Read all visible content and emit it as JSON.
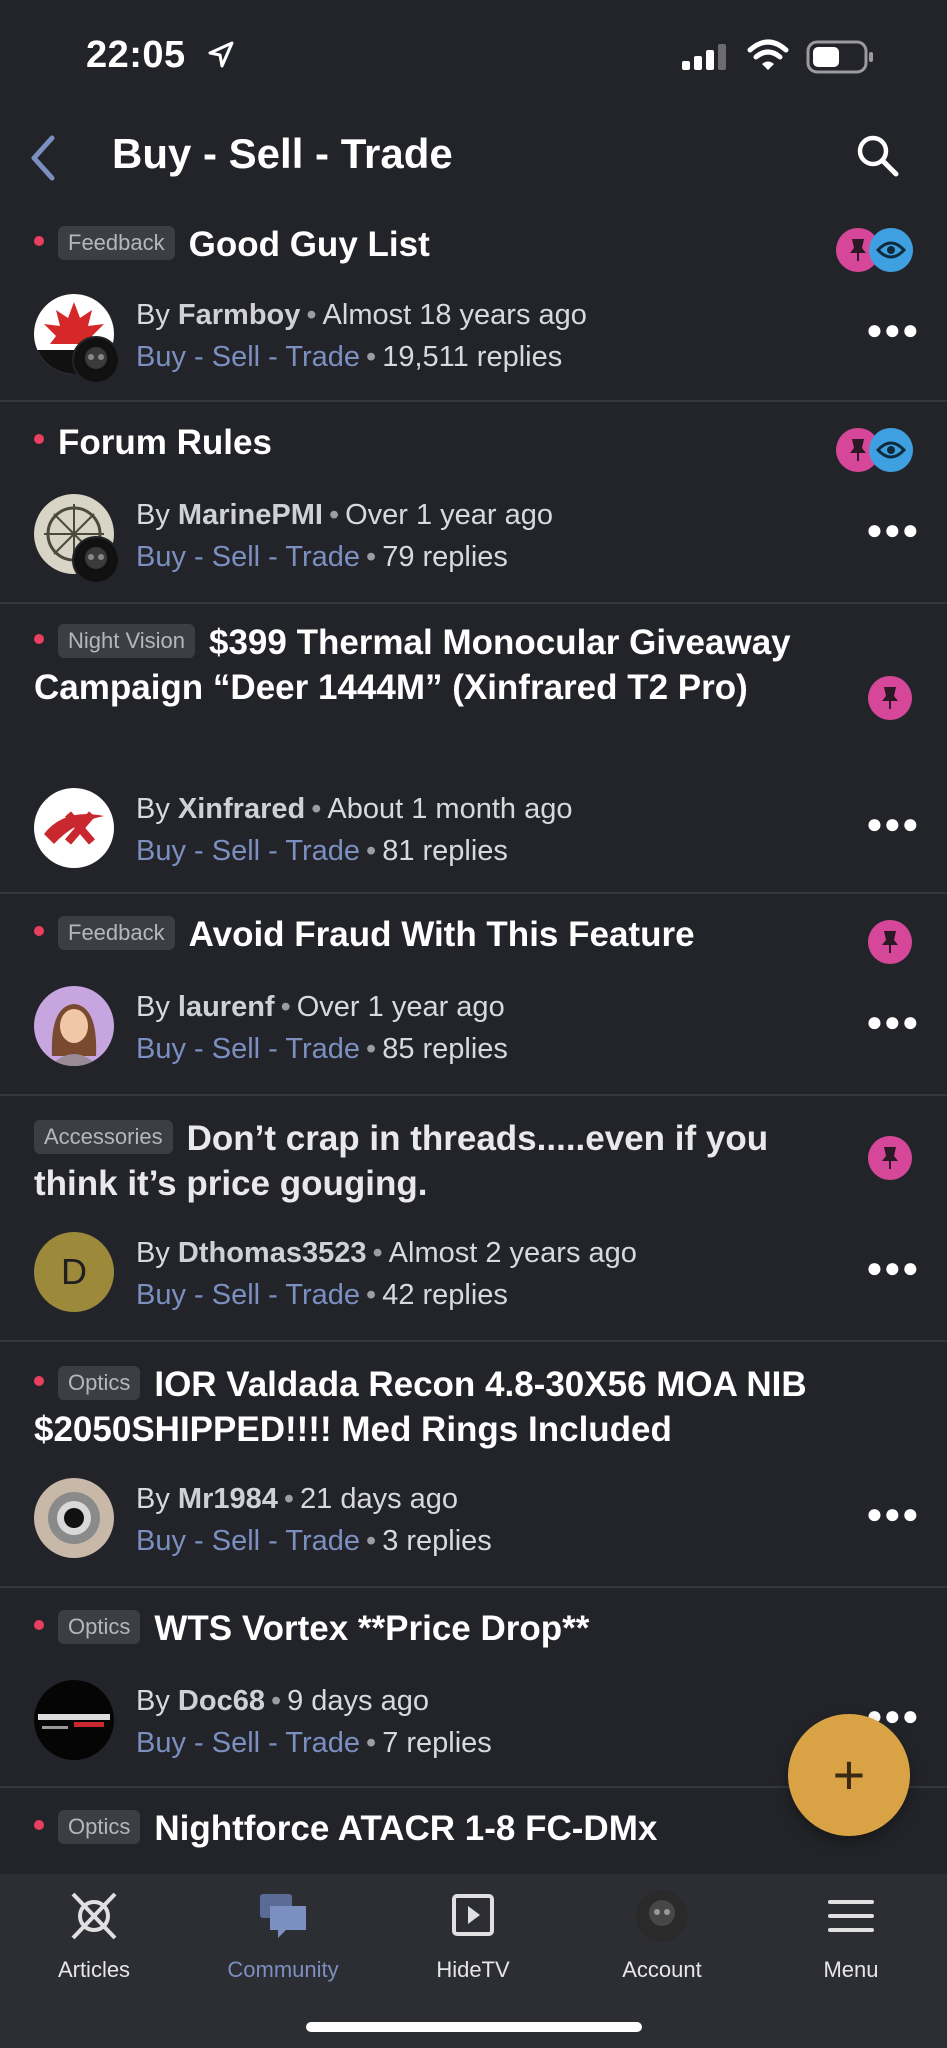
{
  "status_bar": {
    "time": "22:05"
  },
  "nav": {
    "title": "Buy - Sell - Trade"
  },
  "topics": [
    {
      "tag": "Feedback",
      "title": "Good Guy List",
      "author": "Farmboy",
      "age": "Almost 18 years ago",
      "forum": "Buy - Sell - Trade",
      "replies": "19,511 replies"
    },
    {
      "tag": "",
      "title": "Forum Rules",
      "author": "MarinePMI",
      "age": "Over 1 year ago",
      "forum": "Buy - Sell - Trade",
      "replies": "79 replies"
    },
    {
      "tag": "Night Vision",
      "title": "$399 Thermal Monocular Giveaway Campaign “Deer 1444M” (Xinfrared T2 Pro)",
      "author": "Xinfrared",
      "age": "About 1 month ago",
      "forum": "Buy - Sell - Trade",
      "replies": "81 replies"
    },
    {
      "tag": "Feedback",
      "title": "Avoid Fraud With This Feature",
      "author": "laurenf",
      "age": "Over 1 year ago",
      "forum": "Buy - Sell - Trade",
      "replies": "85 replies"
    },
    {
      "tag": "Accessories",
      "title": "Don’t crap in threads.....even if you think it’s price gouging.",
      "author": "Dthomas3523",
      "age": "Almost 2 years ago",
      "forum": "Buy - Sell - Trade",
      "replies": "42 replies",
      "avatar_letter": "D"
    },
    {
      "tag": "Optics",
      "title": "IOR Valdada Recon 4.8-30X56 MOA NIB $2050SHIPPED!!!!  Med Rings Included",
      "author": "Mr1984",
      "age": "21 days ago",
      "forum": "Buy - Sell - Trade",
      "replies": "3 replies"
    },
    {
      "tag": "Optics",
      "title": "WTS Vortex **Price Drop**",
      "author": "Doc68",
      "age": "9 days ago",
      "forum": "Buy - Sell - Trade",
      "replies": "7 replies"
    },
    {
      "tag": "Optics",
      "title": "Nightforce ATACR 1-8 FC-DMx"
    }
  ],
  "meta_words": {
    "by": "By",
    "sep": "•"
  },
  "tabs": [
    {
      "label": "Articles",
      "icon": "articles-logo-icon"
    },
    {
      "label": "Community",
      "icon": "chat-bubbles-icon",
      "active": true
    },
    {
      "label": "HideTV",
      "icon": "play-icon"
    },
    {
      "label": "Account",
      "icon": "avatar"
    },
    {
      "label": "Menu",
      "icon": "hamburger-icon"
    }
  ],
  "colors": {
    "background": "#232429",
    "unread_dot": "#e8405e",
    "pin": "#d6479a",
    "watch": "#3ea0e0",
    "link": "#7b8fc0",
    "fab": "#d9a345"
  }
}
